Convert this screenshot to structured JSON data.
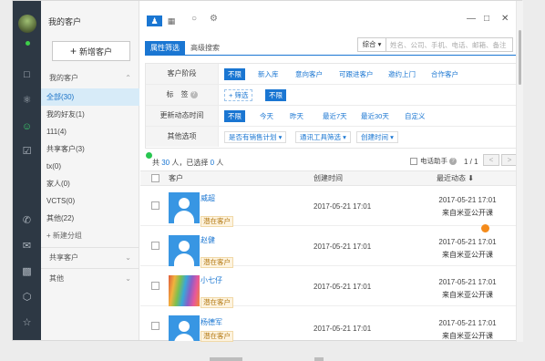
{
  "panel": {
    "title": "我的客户",
    "add_button": "新增客户",
    "sections": [
      {
        "label": "我的客户"
      },
      {
        "label": "共享客户"
      },
      {
        "label": "其他"
      }
    ],
    "items": [
      {
        "label": "全部(30)",
        "selected": true
      },
      {
        "label": "我的好友(1)"
      },
      {
        "label": "111(4)"
      },
      {
        "label": "共享客户(3)"
      },
      {
        "label": "tx(0)"
      },
      {
        "label": "家人(0)"
      },
      {
        "label": "VCTS(0)"
      },
      {
        "label": "其他(22)"
      },
      {
        "label": "+ 新建分组"
      }
    ]
  },
  "left_icons": [
    "chat-icon",
    "share-icon",
    "contacts-icon",
    "task-icon",
    "phone-icon",
    "mail-icon",
    "doc-icon",
    "cube-icon",
    "star-icon"
  ],
  "toolbar": {
    "tabs": [
      {
        "label": "属性筛选"
      },
      {
        "label": "高级搜索"
      }
    ],
    "search_scope": "综合 ▾",
    "search_placeholder": "姓名、公司、手机、电话、邮箱、备注"
  },
  "filters": {
    "stage": {
      "label": "客户阶段",
      "options": [
        "不限",
        "新入库",
        "意向客户",
        "可跟进客户",
        "邀约上门",
        "合作客户"
      ]
    },
    "tags": {
      "label": "标　签",
      "add": "+ 筛选",
      "options": [
        "不限"
      ]
    },
    "update_time": {
      "label": "更新动态时间",
      "options": [
        "不限",
        "今天",
        "昨天",
        "最近7天",
        "最近30天",
        "自定义"
      ]
    },
    "other": {
      "label": "其他选项",
      "dropdowns": [
        "是否有销售计划 ▾",
        "通讯工具筛选 ▾",
        "创建时间 ▾"
      ]
    }
  },
  "summary": {
    "prefix": "共",
    "total": "30",
    "mid": "人，已选择",
    "selected": "0",
    "suffix": "人",
    "remind": "电话助手",
    "page": "1 / 1"
  },
  "table": {
    "headers": [
      "客户",
      "创建时间",
      "最近动态 ⬇"
    ],
    "rows": [
      {
        "name": "威超",
        "tag": "潜在客户",
        "created": "2017-05-21 17:01",
        "recent_time": "2017-05-21 17:01",
        "recent_text": "来自米亚公开课"
      },
      {
        "name": "赵健",
        "tag": "潜在客户",
        "created": "2017-05-21 17:01",
        "recent_time": "2017-05-21 17:01",
        "recent_text": "来自米亚公开课"
      },
      {
        "name": "小七仔",
        "tag": "潜在客户",
        "created": "2017-05-21 17:01",
        "recent_time": "2017-05-21 17:01",
        "recent_text": "来自米亚公开课"
      },
      {
        "name": "杨德军",
        "tag": "潜在客户",
        "created": "2017-05-21 17:01",
        "recent_time": "2017-05-21 17:01",
        "recent_text": "来自米亚公开课"
      }
    ]
  },
  "colors": {
    "accent": "#1a76d2",
    "sidebar": "#2d3844",
    "online": "#3ecf4a"
  }
}
